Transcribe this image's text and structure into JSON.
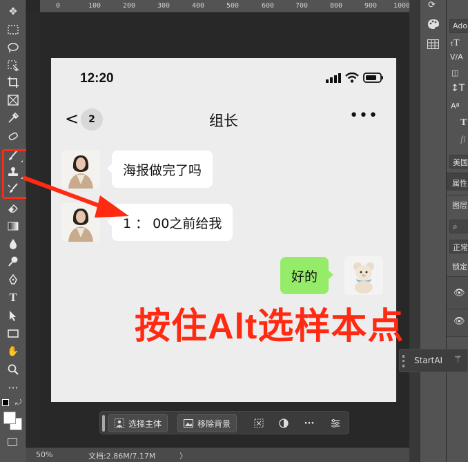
{
  "ruler": {
    "marks": [
      "0",
      "100",
      "200",
      "300",
      "400",
      "500",
      "600",
      "700",
      "800",
      "900",
      "1000"
    ]
  },
  "phone": {
    "time": "12:20",
    "chat_title": "组长",
    "unread_count": "2",
    "messages": [
      {
        "side": "left",
        "text": "海报做完了吗"
      },
      {
        "side": "left",
        "text": "1 ： 00之前给我"
      },
      {
        "side": "right",
        "text": "好的"
      }
    ]
  },
  "annotation": {
    "text": "按住Alt选样本点",
    "color": "#ff2a12"
  },
  "taskbar": {
    "select_subject": "选择主体",
    "remove_background": "移除背景",
    "more": "···"
  },
  "statusbar": {
    "zoom": "50%",
    "doc_info": "文档:2.86M/7.17M",
    "arrow": "〉"
  },
  "right_panel": {
    "font_name": "Adob",
    "lang": "美国",
    "properties_tab": "属性",
    "layers_tab": "图层",
    "blend_mode": "正常",
    "lock_label": "锁定",
    "fi_glyph": "fi"
  },
  "startai": {
    "label": "StartAI"
  },
  "colors": {
    "accent_red": "#ff2a12",
    "bubble_green": "#95ec69",
    "ps_panel": "#535353"
  },
  "icons": [
    "move-icon",
    "marquee-icon",
    "lasso-icon",
    "object-select-icon",
    "crop-icon",
    "frame-icon",
    "eyedropper-icon",
    "spot-heal-icon",
    "brush-icon",
    "clone-stamp-icon",
    "history-brush-icon",
    "eraser-icon",
    "gradient-icon",
    "blur-icon",
    "dodge-icon",
    "pen-icon",
    "type-icon",
    "path-select-icon",
    "rectangle-icon",
    "hand-icon",
    "zoom-icon",
    "more-tools-icon"
  ]
}
